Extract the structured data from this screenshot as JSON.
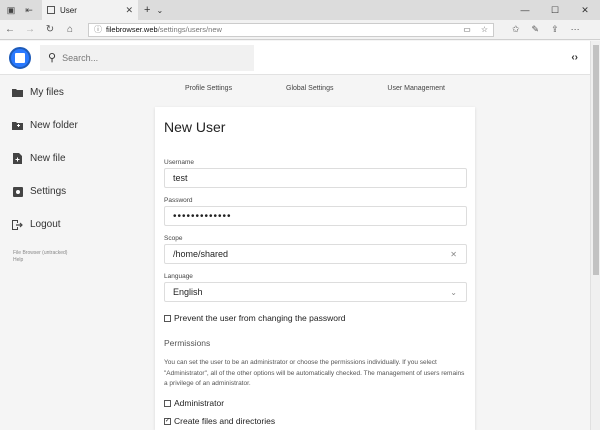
{
  "browser": {
    "tab_title": "User",
    "url_host": "filebrowser.web",
    "url_path": "/settings/users/new"
  },
  "header": {
    "search_placeholder": "Search..."
  },
  "sidebar": {
    "items": [
      {
        "label": "My files",
        "icon": "folder-icon"
      },
      {
        "label": "New folder",
        "icon": "new-folder-icon"
      },
      {
        "label": "New file",
        "icon": "new-file-icon"
      },
      {
        "label": "Settings",
        "icon": "gear-icon"
      },
      {
        "label": "Logout",
        "icon": "logout-icon"
      }
    ],
    "footer_line1": "File Browser (untracked)",
    "footer_line2": "Help"
  },
  "settings_tabs": [
    "Profile Settings",
    "Global Settings",
    "User Management"
  ],
  "form": {
    "title": "New User",
    "username_label": "Username",
    "username_value": "test",
    "password_label": "Password",
    "password_value": "•••••••••••••",
    "scope_label": "Scope",
    "scope_value": "/home/shared",
    "language_label": "Language",
    "language_value": "English",
    "prevent_pw_change_label": "Prevent the user from changing the password",
    "prevent_pw_change_checked": false,
    "permissions_title": "Permissions",
    "permissions_help": "You can set the user to be an administrator or choose the permissions individually. If you select \"Administrator\", all of the other options will be automatically checked. The management of users remains a privilege of an administrator.",
    "administrator_label": "Administrator",
    "administrator_checked": false,
    "create_label": "Create files and directories",
    "create_checked": true
  },
  "colors": {
    "accent": "#2979ff"
  }
}
